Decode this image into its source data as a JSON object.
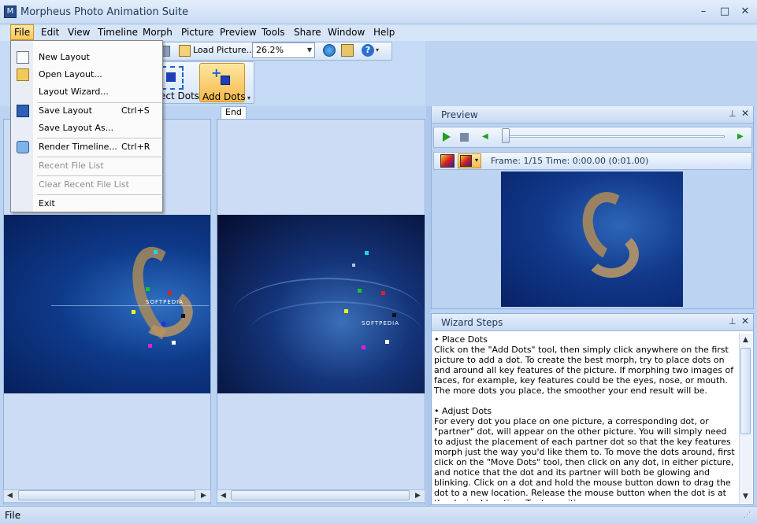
{
  "window": {
    "title": "Morpheus Photo Animation Suite",
    "controls": {
      "minimize": "–",
      "maximize": "□",
      "close": "✕"
    }
  },
  "menu": [
    "File",
    "Edit",
    "View",
    "Timeline",
    "Morph",
    "Picture",
    "Preview",
    "Tools",
    "Share",
    "Window",
    "Help"
  ],
  "toolbar": {
    "load_picture": "Load Picture...",
    "zoom": "26.2%",
    "select_dots_fragment": "ect Dots",
    "add_dots": "Add Dots"
  },
  "file_menu": [
    {
      "label": "New Layout",
      "shortcut": "",
      "enabled": true
    },
    {
      "label": "Open Layout...",
      "shortcut": "",
      "enabled": true
    },
    {
      "label": "Layout Wizard...",
      "shortcut": "",
      "enabled": true
    },
    {
      "label": "Save Layout",
      "shortcut": "Ctrl+S",
      "enabled": true
    },
    {
      "label": "Save Layout As...",
      "shortcut": "",
      "enabled": true
    },
    {
      "label": "Render Timeline...",
      "shortcut": "Ctrl+R",
      "enabled": true
    },
    {
      "label": "Recent File List",
      "shortcut": "",
      "enabled": false
    },
    {
      "label": "Clear Recent File List",
      "shortcut": "",
      "enabled": false
    },
    {
      "label": "Exit",
      "shortcut": "",
      "enabled": true
    }
  ],
  "editor": {
    "end_tab": "End",
    "start_image_text": "SOFTPEDIA",
    "end_image_text": "SOFTPEDIA"
  },
  "preview": {
    "title": "Preview",
    "frame_info": "Frame: 1/15 Time: 0:00.00 (0:01.00)",
    "progress": 0
  },
  "wizard": {
    "title": "Wizard Steps",
    "sections": [
      {
        "heading": "• Place Dots",
        "body": "Click on the \"Add Dots\" tool, then simply click anywhere on the first picture to add a dot.  To create the best morph, try to place dots on and around all key features of the picture.  If morphing two images of faces, for example, key features could be the eyes, nose, or mouth.  The more dots you place, the smoother your end result will be."
      },
      {
        "heading": "• Adjust Dots",
        "body": "For every dot you place on one picture, a corresponding dot, or \"partner\" dot, will appear on the other picture.  You will simply need to adjust the placement of each partner dot so that the key features morph just the way you'd like them to.  To move the dots around, first click on the \"Move Dots\" tool, then click on any dot, in either picture, and notice that the dot and its partner will both be glowing and blinking.  Click on a dot and hold the mouse button down to drag the dot to a new location.  Release the mouse button when the dot is at the desired location.  Try to position"
      }
    ]
  },
  "status": {
    "text": "File"
  },
  "colors": {
    "accent": "#fbd47a",
    "frame": "#bcd3f1",
    "image_bg": "#0b2a6b"
  }
}
